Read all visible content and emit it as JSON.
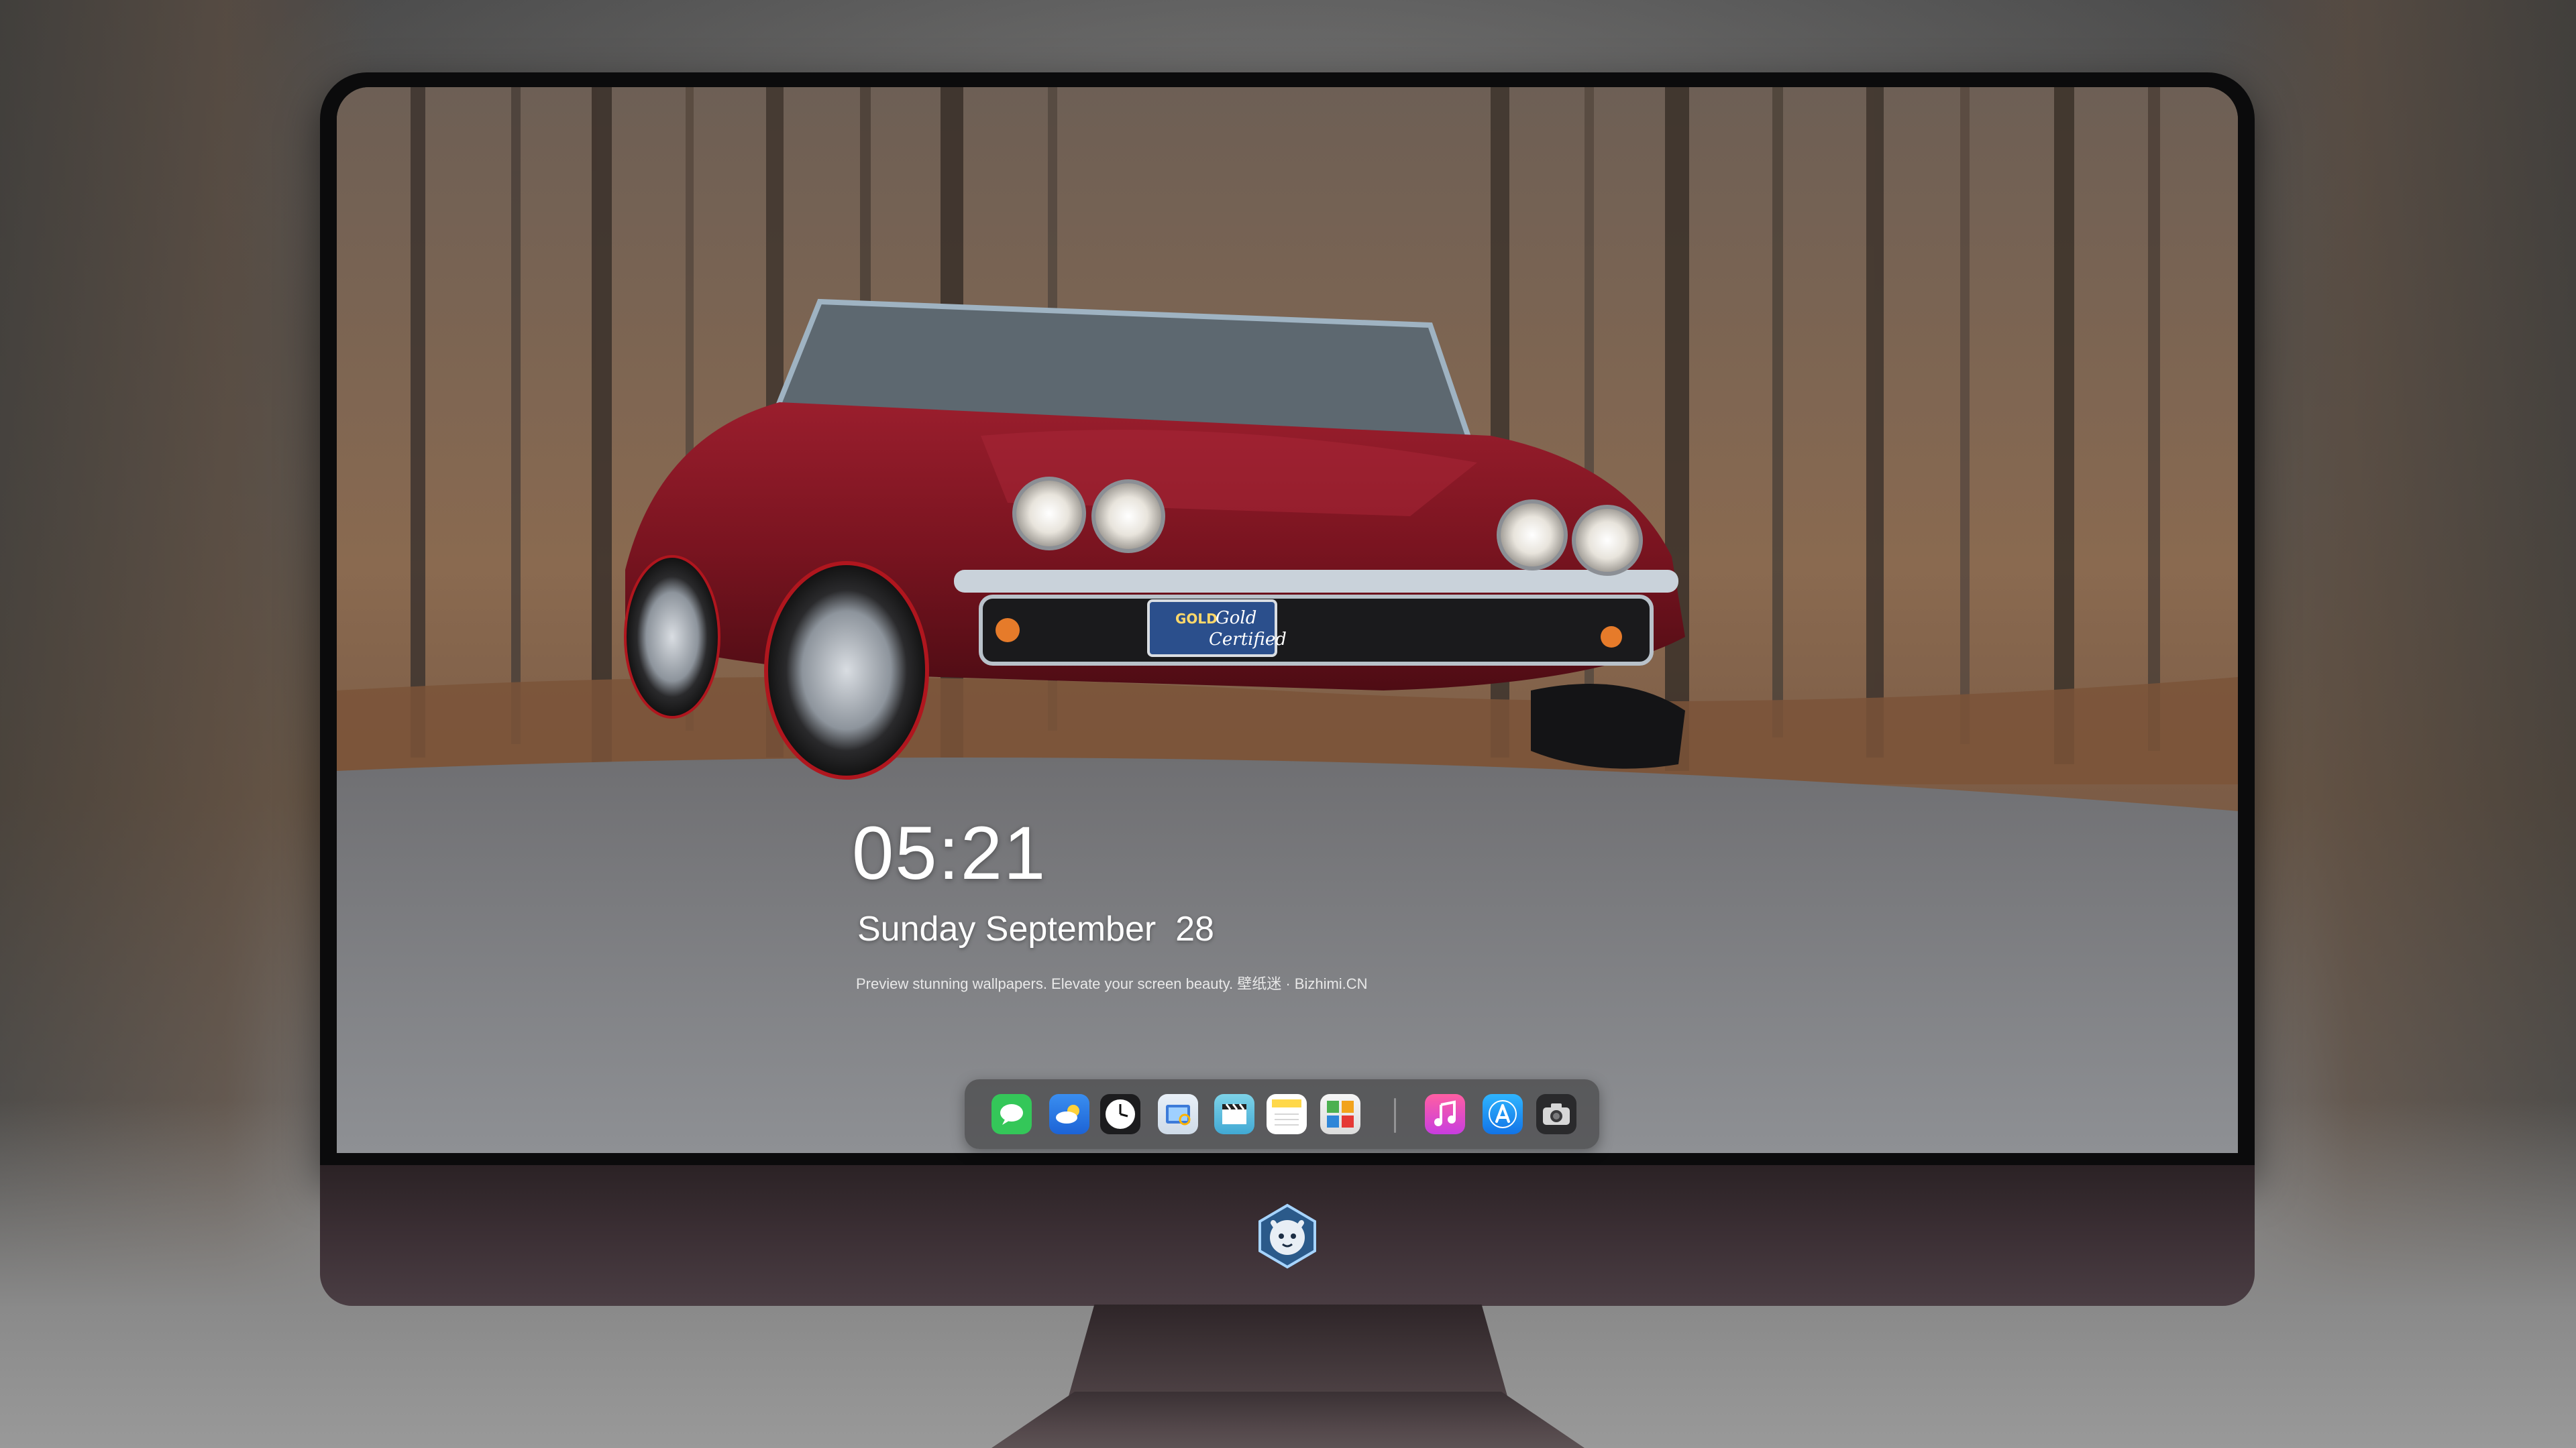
{
  "lockscreen": {
    "time": "05:21",
    "date": "Sunday September  28",
    "caption": "Preview stunning wallpapers. Elevate your screen beauty. 壁纸迷 · Bizhimi.CN"
  },
  "wallpaper": {
    "license_plate_line1": "Gold",
    "license_plate_line2": "Certified",
    "license_plate_badge": "GOLD"
  },
  "dock": {
    "apps": [
      {
        "name": "messages-icon"
      },
      {
        "name": "weather-icon"
      },
      {
        "name": "clock-icon"
      },
      {
        "name": "preview-icon"
      },
      {
        "name": "clips-icon"
      },
      {
        "name": "notes-icon"
      },
      {
        "name": "photo-booth-icon"
      },
      {
        "name": "music-icon"
      },
      {
        "name": "app-store-icon"
      },
      {
        "name": "camera-icon"
      }
    ]
  },
  "colors": {
    "car_body": "#7a1420",
    "dock_bg": "#464648",
    "bezel": "#0b0b0c",
    "chin": "#3a2e33"
  }
}
